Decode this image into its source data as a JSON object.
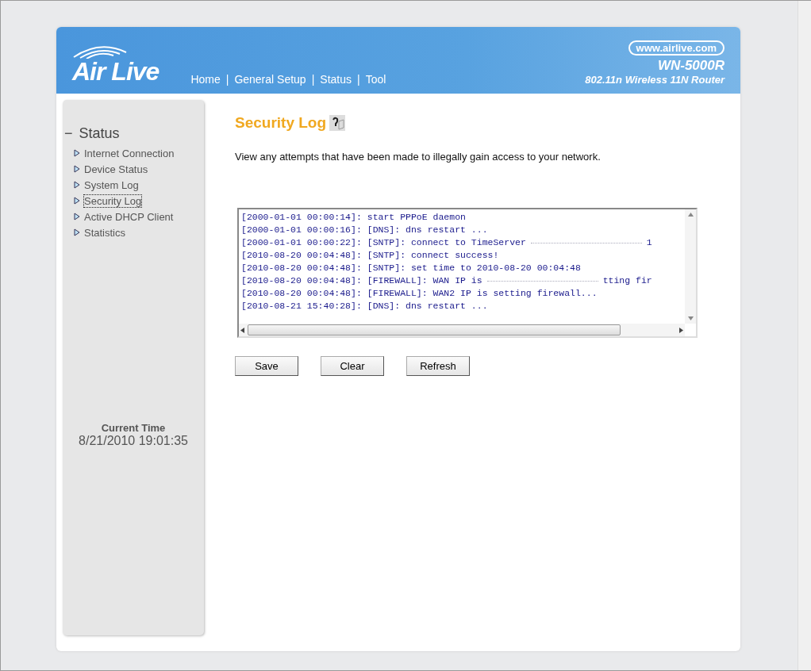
{
  "header": {
    "logo": "Air Live",
    "nav": [
      "Home",
      "General Setup",
      "Status",
      "Tool"
    ],
    "nav_separator": "|",
    "site": "www.airlive.com",
    "model": "WN-5000R",
    "subtitle": "802.11n Wireless 11N Router"
  },
  "sidebar": {
    "section": {
      "label": "Status",
      "toggle": "−"
    },
    "items": [
      {
        "label": "Internet Connection",
        "selected": false
      },
      {
        "label": "Device Status",
        "selected": false
      },
      {
        "label": "System Log",
        "selected": false
      },
      {
        "label": "Security Log",
        "selected": true
      },
      {
        "label": "Active DHCP Client",
        "selected": false
      },
      {
        "label": "Statistics",
        "selected": false
      }
    ],
    "time_label": "Current Time",
    "time_value": "8/21/2010 19:01:35"
  },
  "content": {
    "title": "Security Log",
    "description": "View any attempts that have been made to illegally gain access to your network.",
    "log": [
      {
        "text": "[2000-01-01 00:00:14]: start PPPoE daemon"
      },
      {
        "text": "[2000-01-01 00:00:16]: [DNS]: dns restart ..."
      },
      {
        "text": "[2000-01-01 00:00:22]: [SNTP]: connect to TimeServer",
        "tail": "1"
      },
      {
        "text": "[2010-08-20 00:04:48]: [SNTP]: connect success!"
      },
      {
        "text": "[2010-08-20 00:04:48]: [SNTP]: set time to 2010-08-20 00:04:48"
      },
      {
        "text": "[2010-08-20 00:04:48]: [FIREWALL]: WAN IP is",
        "tail": "tting fir"
      },
      {
        "text": "[2010-08-20 00:04:48]: [FIREWALL]: WAN2 IP is setting firewall..."
      },
      {
        "text": "[2010-08-21 15:40:28]: [DNS]: dns restart ..."
      }
    ],
    "buttons": [
      "Save",
      "Clear",
      "Refresh"
    ]
  }
}
